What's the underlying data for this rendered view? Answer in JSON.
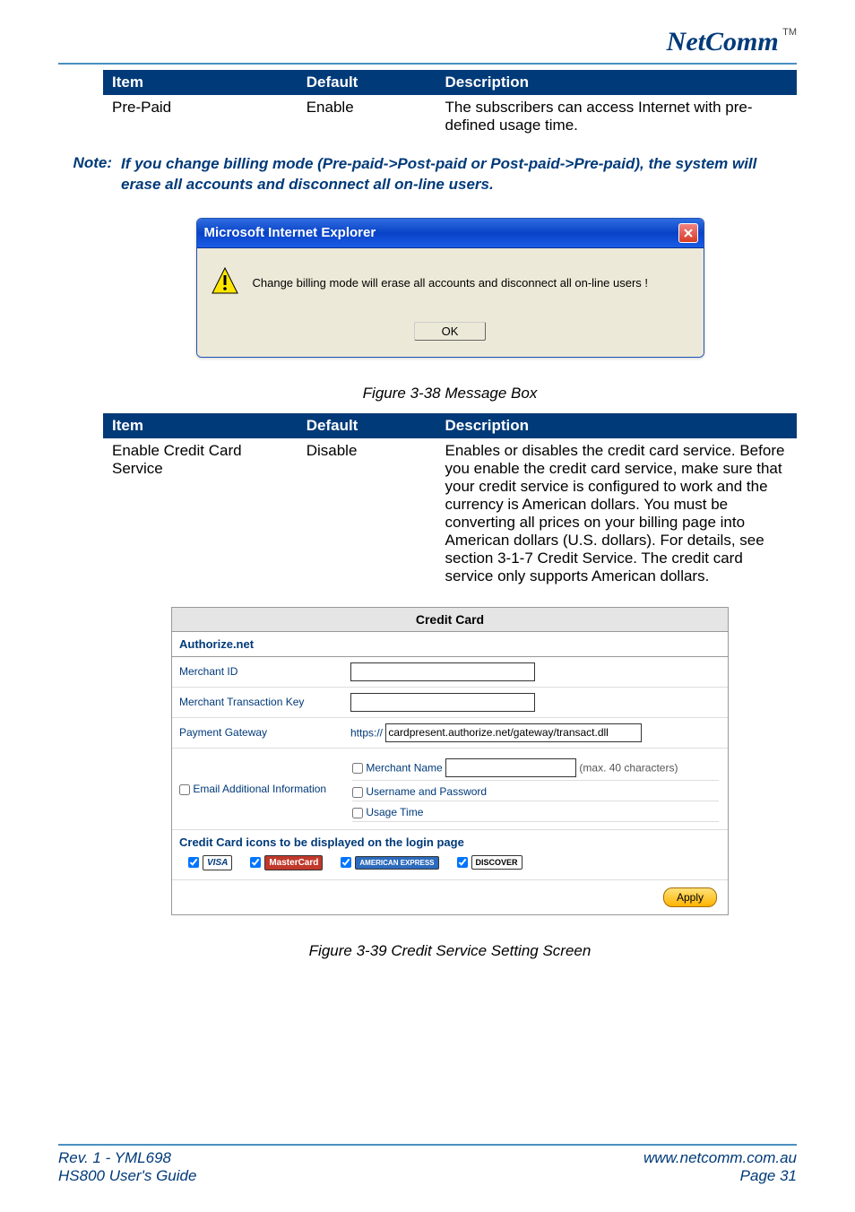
{
  "brand": {
    "logo": "NetComm",
    "tm": "TM"
  },
  "table1": {
    "headers": [
      "Item",
      "Default",
      "Description"
    ],
    "rows": [
      {
        "item": "Pre-Paid",
        "default": "Enable",
        "description": "The subscribers can access Internet with pre-defined usage time."
      }
    ]
  },
  "note": {
    "label": "Note:",
    "text": "If you change billing mode (Pre-paid->Post-paid or Post-paid->Pre-paid), the system will erase all accounts and disconnect all on-line users."
  },
  "dialog": {
    "title": "Microsoft Internet Explorer",
    "message": "Change billing mode will erase all accounts and disconnect all on-line users !",
    "ok": "OK"
  },
  "caption1": "Figure 3-38 Message Box",
  "table2": {
    "headers": [
      "Item",
      "Default",
      "Description"
    ],
    "rows": [
      {
        "item": "Enable Credit Card Service",
        "default": "Disable",
        "description": "Enables or disables the credit card service. Before you enable the credit card service, make sure that your credit service is configured to work and the currency is American dollars. You must be converting all prices on your billing page into American dollars (U.S. dollars). For details, see section 3-1-7 Credit Service. The credit card service only supports American dollars."
      }
    ]
  },
  "cc_panel": {
    "title": "Credit Card",
    "sub": "Authorize.net",
    "merchant_id_label": "Merchant ID",
    "merchant_txn_label": "Merchant Transaction Key",
    "gateway_label": "Payment Gateway",
    "gateway_prefix": "https://",
    "gateway_value": "cardpresent.authorize.net/gateway/transact.dll",
    "email_label": "Email Additional Information",
    "merchant_name_label": "Merchant Name",
    "merchant_name_note": "(max. 40 characters)",
    "up_label": "Username and Password",
    "usage_label": "Usage Time",
    "icons_head": "Credit Card icons to be displayed on the login page",
    "cards": {
      "visa": "VISA",
      "mc": "MasterCard",
      "amex": "AMERICAN EXPRESS",
      "discover": "DISCOVER"
    },
    "apply": "Apply"
  },
  "caption2": "Figure 3-39 Credit Service Setting Screen",
  "footer": {
    "rev": "Rev. 1 - YML698",
    "guide": "HS800 User's Guide",
    "url": "www.netcomm.com.au",
    "page": "Page 31"
  }
}
